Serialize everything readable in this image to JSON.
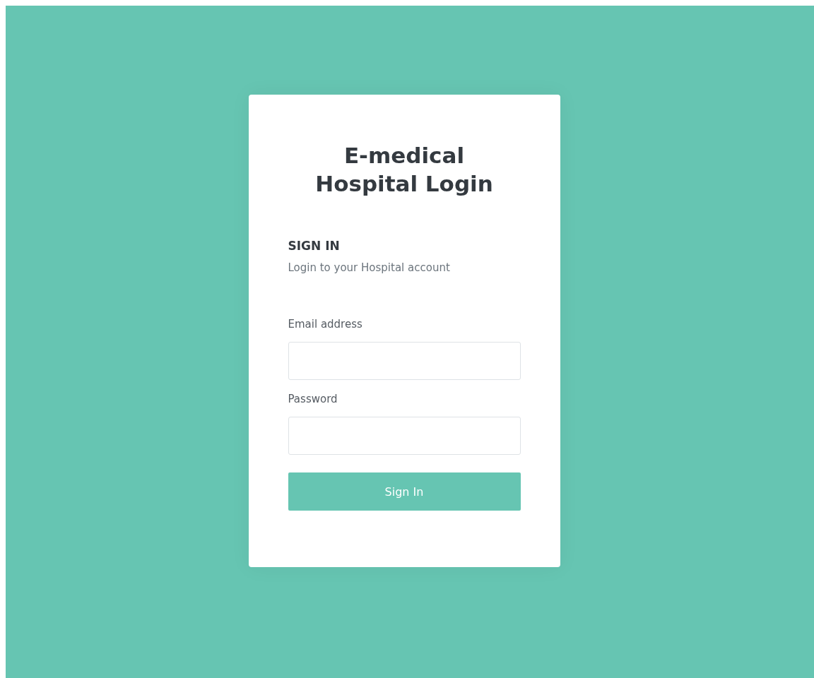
{
  "card": {
    "title": "E-medical Hospital Login",
    "heading": "SIGN IN",
    "subtitle": "Login to your Hospital account"
  },
  "fields": [
    {
      "label": "Email address"
    },
    {
      "label": "Password"
    }
  ],
  "submit_button": "Sign In"
}
